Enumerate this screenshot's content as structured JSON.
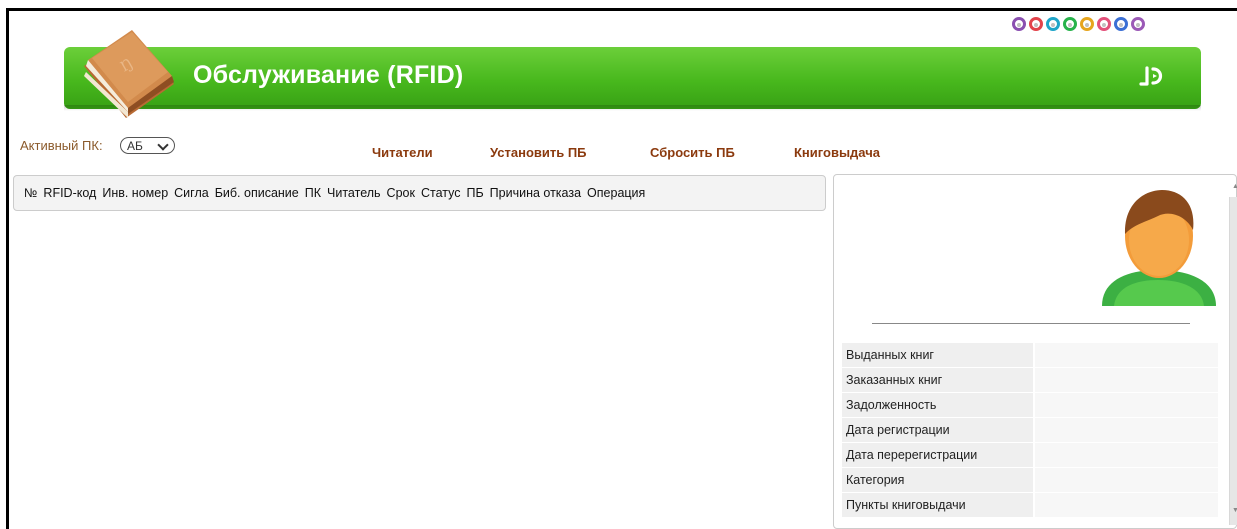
{
  "header": {
    "title": "Обслуживание (RFID)",
    "app_icon": "book-icon",
    "right_logo": "logo-mark-icon",
    "top_icon_colors": [
      "#8a4fb0",
      "#e2434b",
      "#1fa5c9",
      "#27b24a",
      "#e6a51e",
      "#e3507a",
      "#3b6fd4",
      "#9b59b6"
    ]
  },
  "toolbar": {
    "active_pk_label": "Активный ПК:",
    "active_pk_value": "АБ"
  },
  "nav": {
    "readers": "Читатели",
    "set_pb": "Установить ПБ",
    "reset_pb": "Сбросить ПБ",
    "circulation": "Книговыдача"
  },
  "table": {
    "columns": [
      "№",
      "RFID-код",
      "Инв. номер",
      "Сигла",
      "Биб. описание",
      "ПК",
      "Читатель",
      "Срок",
      "Статус",
      "ПБ",
      "Причина отказа",
      "Операция"
    ],
    "rows": []
  },
  "reader_panel": {
    "avatar": "user-avatar-icon",
    "stats": [
      {
        "label": "Выданных книг",
        "value": ""
      },
      {
        "label": "Заказанных книг",
        "value": ""
      },
      {
        "label": "Задолженность",
        "value": ""
      },
      {
        "label": "Дата регистрации",
        "value": ""
      },
      {
        "label": "Дата перерегистрации",
        "value": ""
      },
      {
        "label": "Категория",
        "value": ""
      },
      {
        "label": "Пункты книговыдачи",
        "value": ""
      }
    ]
  },
  "colors": {
    "banner_green": "#48b81d",
    "nav_link": "#8b3a0e",
    "label_brown": "#8b5a2b"
  }
}
